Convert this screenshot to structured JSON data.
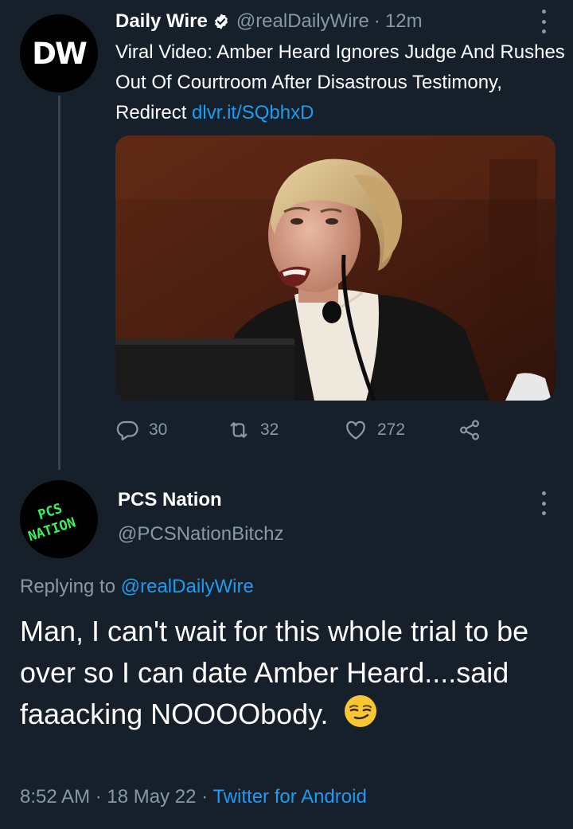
{
  "tweet1": {
    "avatar_text": "DW",
    "display_name": "Daily Wire",
    "handle": "@realDailyWire",
    "separator": "·",
    "time": "12m",
    "text": "Viral Video: Amber Heard Ignores Judge And Rushes Out Of Courtroom After Disastrous Testimony, Redirect ",
    "link": "dlvr.it/SQbhxD",
    "media_alt": "Woman with blonde hair speaking into a microphone on a witness stand",
    "stats": {
      "replies": "30",
      "retweets": "32",
      "likes": "272"
    }
  },
  "tweet2": {
    "display_name": "PCS Nation",
    "handle": "@PCSNationBitchz",
    "avatar_lines": [
      "PCS",
      "NATION"
    ],
    "replying_prefix": "Replying to ",
    "replying_handle": "@realDailyWire",
    "text": "Man, I can't wait for this whole trial to be over so I can date Amber Heard....said faaacking NOOOObody.",
    "meta_time": "8:52 AM",
    "meta_sep1": " · ",
    "meta_date": "18 May 22",
    "meta_sep2": " · ",
    "meta_client": "Twitter for Android"
  },
  "colors": {
    "background": "#15202b",
    "muted": "#8899a6",
    "link": "#1d9bf0",
    "thread_line": "#38444d",
    "pcs_green": "#38f05a"
  },
  "icons": [
    "verified-badge-icon",
    "more-icon",
    "reply-icon",
    "retweet-icon",
    "like-icon",
    "share-icon",
    "smirk-emoji-icon"
  ]
}
